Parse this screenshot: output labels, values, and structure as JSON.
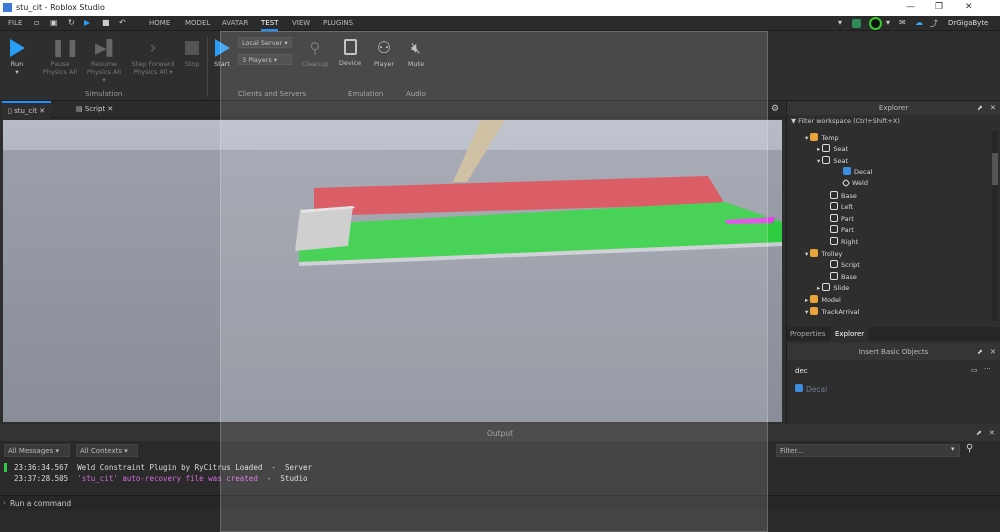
{
  "window": {
    "title": "stu_cit - Roblox Studio",
    "user": "DrGigaByte"
  },
  "menu": [
    "FILE",
    "HOME",
    "MODEL",
    "AVATAR",
    "TEST",
    "VIEW",
    "PLUGINS"
  ],
  "menu_active": "TEST",
  "ribbon": {
    "simulation": {
      "run": "Run",
      "pause": "Pause Physics All",
      "resume": "Resume Physics All ▾",
      "step": "Step Forward Physics All ▾",
      "stop": "Stop",
      "group": "Simulation"
    },
    "clients": {
      "start": "Start",
      "server": "Local Server",
      "players": "3 Players",
      "cleanup": "Cleanup",
      "group": "Clients and Servers"
    },
    "emulation": {
      "device": "Device",
      "player": "Player",
      "group": "Emulation"
    },
    "audio": {
      "mute": "Mute",
      "group": "Audio"
    }
  },
  "tabs": [
    {
      "label": "stu_cit"
    },
    {
      "label": "Script"
    }
  ],
  "explorer": {
    "title": "Explorer",
    "filter_placeholder": "Filter workspace (Ctrl+Shift+X)",
    "items": [
      {
        "label": "Temp",
        "icon": "model-icon"
      },
      {
        "label": "Seat",
        "icon": "seat-icon"
      },
      {
        "label": "Seat",
        "icon": "seat-icon"
      },
      {
        "label": "Decal",
        "icon": "decal-icon"
      },
      {
        "label": "Weld",
        "icon": "weld-icon"
      },
      {
        "label": "Base",
        "icon": "part-icon"
      },
      {
        "label": "Left",
        "icon": "part-icon"
      },
      {
        "label": "Part",
        "icon": "part-icon"
      },
      {
        "label": "Part",
        "icon": "part-icon"
      },
      {
        "label": "Right",
        "icon": "part-icon"
      },
      {
        "label": "Trolley",
        "icon": "model-icon"
      },
      {
        "label": "Script",
        "icon": "script-icon"
      },
      {
        "label": "Base",
        "icon": "part-icon"
      },
      {
        "label": "Slide",
        "icon": "part-icon"
      },
      {
        "label": "Model",
        "icon": "model-icon"
      },
      {
        "label": "TrackArrival",
        "icon": "model-icon"
      }
    ],
    "tabs": [
      "Properties",
      "Explorer"
    ]
  },
  "insert": {
    "title": "Insert Basic Objects",
    "search_value": "dec",
    "result": "Decal"
  },
  "output": {
    "title": "Output",
    "filter1": "All Messages",
    "filter2": "All Contexts",
    "filter_placeholder": "Filter...",
    "lines": [
      {
        "time": "23:36:34.567",
        "text": "Weld Constraint Plugin by RyCitrus Loaded",
        "src": "Server"
      },
      {
        "time": "23:37:28.505",
        "text": "'stu_cit' auto-recovery file was created",
        "src": "Studio"
      }
    ],
    "command_placeholder": "Run a command"
  }
}
